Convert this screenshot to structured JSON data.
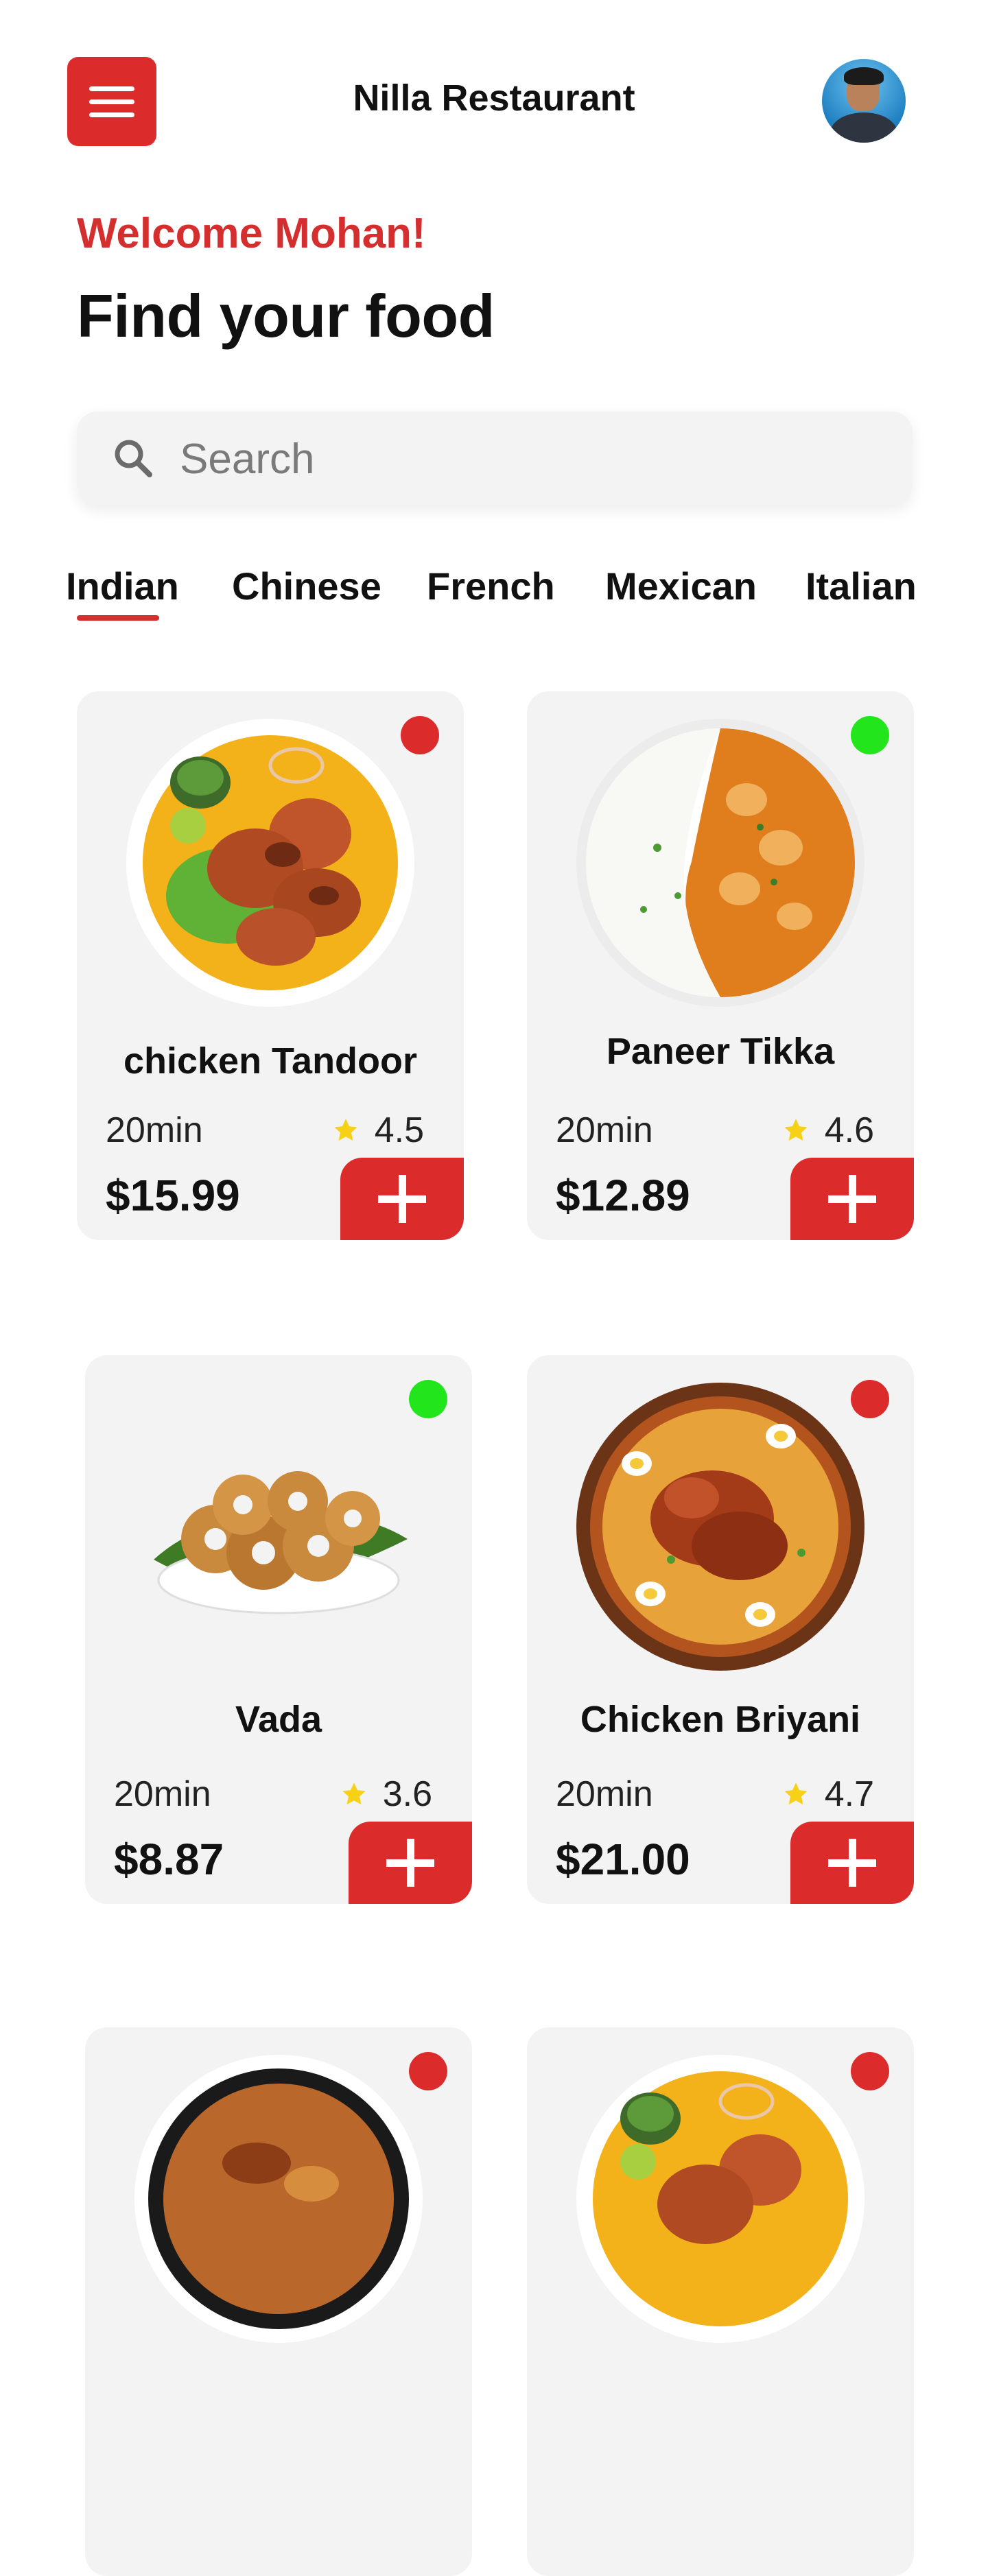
{
  "header": {
    "title": "Nilla Restaurant"
  },
  "greeting": {
    "welcome": "Welcome Mohan!",
    "headline": "Find your food"
  },
  "search": {
    "placeholder": "Search"
  },
  "tabs": [
    {
      "label": "Indian",
      "active": true
    },
    {
      "label": "Chinese",
      "active": false
    },
    {
      "label": "French",
      "active": false
    },
    {
      "label": "Mexican",
      "active": false
    },
    {
      "label": "Italian",
      "active": false
    }
  ],
  "colors": {
    "accent": "#dc2b2b",
    "non_veg_indicator": "#dc2b2b",
    "veg_indicator": "#22e51c",
    "star": "#f7d117"
  },
  "foods": [
    {
      "name": "chicken Tandoor",
      "time": "20min",
      "rating": "4.5",
      "price": "$15.99",
      "indicator": "non-veg"
    },
    {
      "name": "Paneer Tikka",
      "time": "20min",
      "rating": "4.6",
      "price": "$12.89",
      "indicator": "veg"
    },
    {
      "name": "Vada",
      "time": "20min",
      "rating": "3.6",
      "price": "$8.87",
      "indicator": "veg"
    },
    {
      "name": "Chicken Briyani",
      "time": "20min",
      "rating": "4.7",
      "price": "$21.00",
      "indicator": "non-veg"
    }
  ],
  "icons": {
    "menu": "hamburger-menu-icon",
    "search": "search-icon",
    "star": "star-icon",
    "add": "plus-icon"
  }
}
